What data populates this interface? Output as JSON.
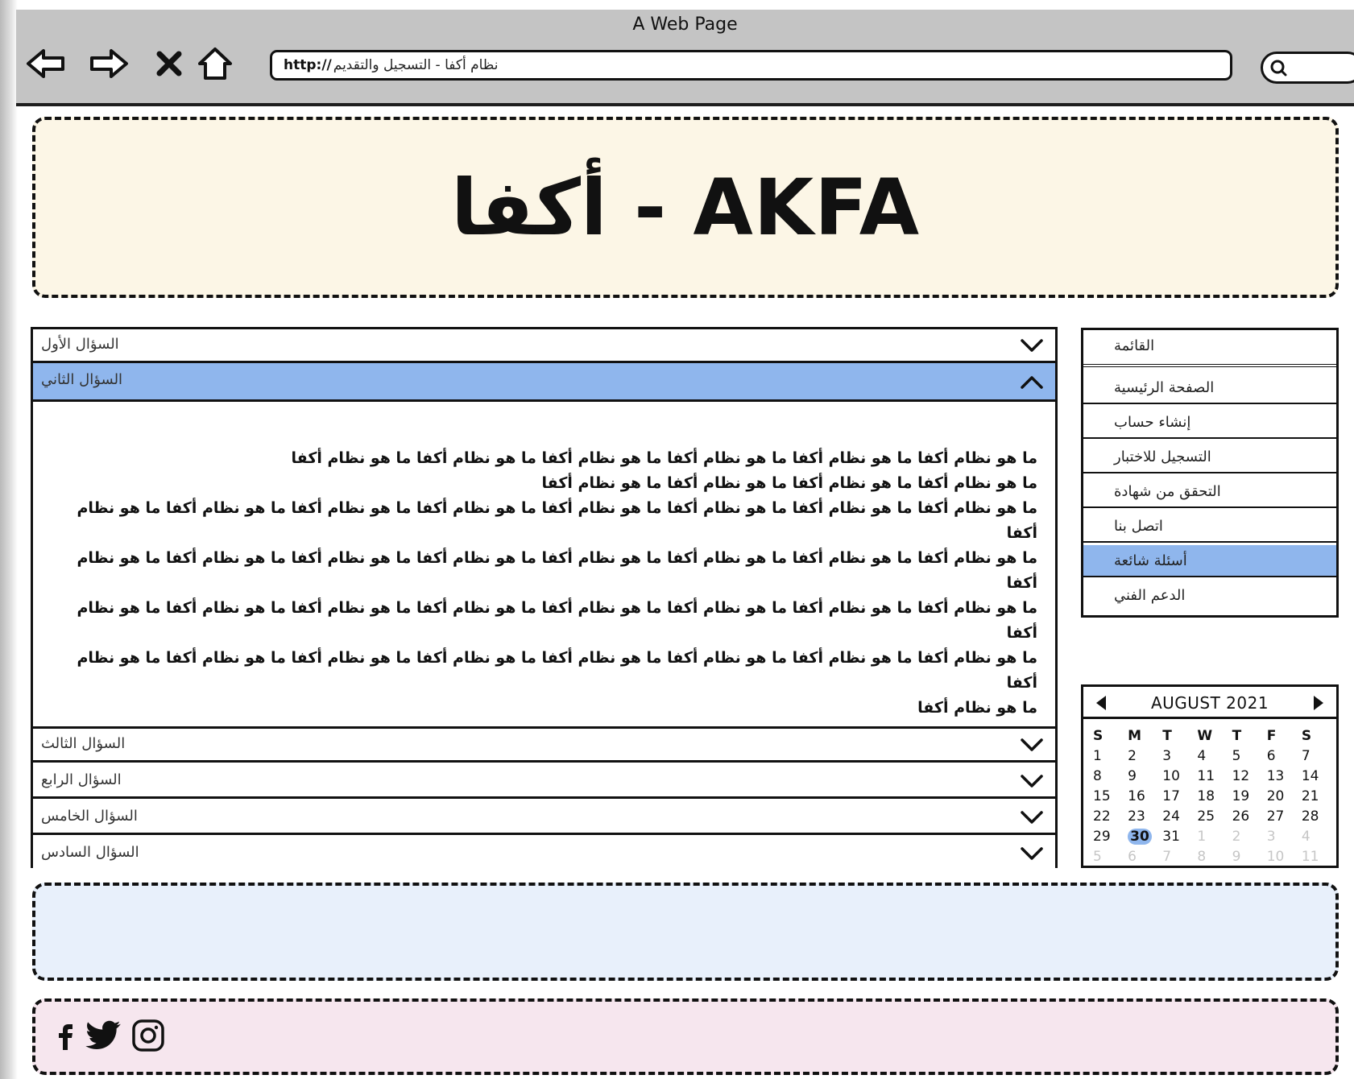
{
  "window": {
    "title": "A Web Page"
  },
  "browser": {
    "url_protocol": "http://",
    "url_path": "نظام أكفا - التسجيل والتقديم",
    "search_icon": "search-icon"
  },
  "banner": {
    "title": "أكفا - AKFA"
  },
  "accordion": {
    "items": [
      {
        "label": "السؤال الأول",
        "expanded": false
      },
      {
        "label": "السؤال الثاني",
        "expanded": true
      },
      {
        "label": "السؤال الثالث",
        "expanded": false
      },
      {
        "label": "السؤال الرابع",
        "expanded": false
      },
      {
        "label": "السؤال الخامس",
        "expanded": false
      },
      {
        "label": "السؤال السادس",
        "expanded": false
      }
    ],
    "content_lines": [
      "ما هو نظام أكفا ما هو نظام أكفا ما هو نظام أكفا ما هو نظام أكفا ما هو نظام أكفا ما هو نظام أكفا",
      "ما هو نظام أكفا ما هو نظام أكفا ما هو نظام أكفا ما هو نظام أكفا",
      "ما هو نظام أكفا ما هو نظام أكفا ما هو نظام أكفا ما هو نظام أكفا ما هو نظام أكفا ما هو نظام أكفا ما هو نظام أكفا ما هو نظام أكفا",
      "ما هو نظام أكفا ما هو نظام أكفا ما هو نظام أكفا ما هو نظام أكفا ما هو نظام أكفا ما هو نظام أكفا ما هو نظام أكفا ما هو نظام أكفا",
      "ما هو نظام أكفا ما هو نظام أكفا ما هو نظام أكفا ما هو نظام أكفا ما هو نظام أكفا ما هو نظام أكفا ما هو نظام أكفا ما هو نظام أكفا",
      "ما هو نظام أكفا ما هو نظام أكفا ما هو نظام أكفا ما هو نظام أكفا ما هو نظام أكفا ما هو نظام أكفا ما هو نظام أكفا ما هو نظام أكفا",
      "ما هو نظام أكفا"
    ]
  },
  "menu": {
    "header": "القائمة",
    "items": [
      {
        "label": "الصفحة الرئيسية",
        "selected": false
      },
      {
        "label": "إنشاء حساب",
        "selected": false
      },
      {
        "label": "التسجيل للاختبار",
        "selected": false
      },
      {
        "label": "التحقق من شهادة",
        "selected": false
      },
      {
        "label": "اتصل بنا",
        "selected": false
      },
      {
        "label": "أسئلة شائعة",
        "selected": true
      },
      {
        "label": "الدعم الفني",
        "selected": false
      }
    ]
  },
  "calendar": {
    "month_label": "AUGUST 2021",
    "weekdays": [
      "S",
      "M",
      "T",
      "W",
      "T",
      "F",
      "S"
    ],
    "days": [
      [
        1,
        2,
        3,
        4,
        5,
        6,
        7
      ],
      [
        8,
        9,
        10,
        11,
        12,
        13,
        14
      ],
      [
        15,
        16,
        17,
        18,
        19,
        20,
        21
      ],
      [
        22,
        23,
        24,
        25,
        26,
        27,
        28
      ],
      [
        29,
        30,
        31,
        1,
        2,
        3,
        4
      ],
      [
        5,
        6,
        7,
        8,
        9,
        10,
        11
      ]
    ],
    "selected_day": 30,
    "trailing_from_row4_col": 3
  },
  "footer": {
    "social_icons": [
      "facebook-icon",
      "twitter-icon",
      "instagram-icon"
    ]
  },
  "colors": {
    "accent_blue": "#8fb6ed",
    "chrome_gray": "#c4c4c4",
    "banner_bg": "#fcf6e6",
    "footer_blue_bg": "#e8f0fb",
    "footer_pink_bg": "#f6e6ee"
  }
}
